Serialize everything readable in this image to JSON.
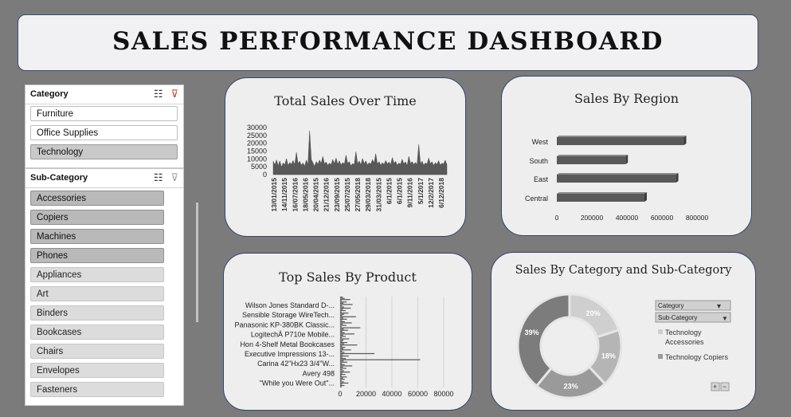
{
  "dashboard": {
    "title": "SALES PERFORMANCE DASHBOARD"
  },
  "category_slicer": {
    "title": "Category",
    "items": [
      {
        "label": "Furniture",
        "selected": false
      },
      {
        "label": "Office Supplies",
        "selected": false
      },
      {
        "label": "Technology",
        "selected": true
      }
    ]
  },
  "subcategory_slicer": {
    "title": "Sub-Category",
    "items": [
      {
        "label": "Accessories",
        "selected": true
      },
      {
        "label": "Copiers",
        "selected": true
      },
      {
        "label": "Machines",
        "selected": true
      },
      {
        "label": "Phones",
        "selected": true
      },
      {
        "label": "Appliances",
        "selected": false
      },
      {
        "label": "Art",
        "selected": false
      },
      {
        "label": "Binders",
        "selected": false
      },
      {
        "label": "Bookcases",
        "selected": false
      },
      {
        "label": "Chairs",
        "selected": false
      },
      {
        "label": "Envelopes",
        "selected": false
      },
      {
        "label": "Fasteners",
        "selected": false
      }
    ]
  },
  "icons": {
    "multi_select": "multi-select-icon",
    "clear_filter": "clear-filter-icon"
  },
  "colors": {
    "bar": "#595959",
    "background": "#7b7b7b",
    "card": "#eeeeef",
    "card_border": "#34446a"
  },
  "pivot_buttons": {
    "category": "Category",
    "subcategory": "Sub-Category"
  },
  "chart_data": [
    {
      "type": "area",
      "title": "Total Sales Over Time",
      "y_ticks": [
        0,
        5000,
        10000,
        15000,
        20000,
        25000,
        30000
      ],
      "ylim": [
        0,
        30000
      ],
      "x_tick_labels": [
        "13/01/2015",
        "14/11/2015",
        "16/07/2016",
        "18/05/2016",
        "20/04/2015",
        "21/12/2016",
        "23/09/2015",
        "25/07/2015",
        "27/05/2018",
        "29/03/2018",
        "31/03/2015",
        "6/1/2015",
        "6/1/2015",
        "9/11/2016",
        "5/1/2017",
        "12/2/2017",
        "6/12/2018"
      ],
      "values": [
        8500,
        6200,
        9400,
        5600,
        8800,
        4700,
        7600,
        6100,
        10200,
        5800,
        7800,
        6500,
        9000,
        6200,
        14200,
        7100,
        8600,
        6000,
        7500,
        5300,
        9200,
        6400,
        28000,
        9600,
        7700,
        5200,
        8400,
        6600,
        9300,
        7100,
        11600,
        6800,
        8100,
        5900,
        7400,
        6300,
        9700,
        7000,
        10600,
        6500,
        8900,
        6100,
        7800,
        6600,
        12400,
        7200,
        8300,
        5600,
        7100,
        6300,
        14700,
        6900,
        8700,
        6200,
        10300,
        7000,
        8800,
        6100,
        7600,
        6700,
        9600,
        7300,
        13300,
        6600,
        8400,
        5900,
        7700,
        6500,
        9000,
        6800,
        8100,
        6300,
        10900,
        7200,
        8500,
        6000,
        7400,
        6600,
        9800,
        6900,
        8200,
        5700,
        11700,
        7100,
        8300,
        6400,
        7900,
        6200,
        19300,
        6800,
        8600,
        6000,
        7500,
        6700,
        10600,
        6900,
        8300,
        5800,
        7700,
        6500,
        8900,
        6100,
        7300,
        6700,
        9200,
        6400
      ]
    },
    {
      "type": "bar",
      "orientation": "horizontal",
      "title": "Sales By Region",
      "categories": [
        "West",
        "South",
        "East",
        "Central"
      ],
      "values": [
        725000,
        392000,
        680000,
        500000
      ],
      "x_ticks": [
        0,
        200000,
        400000,
        600000,
        800000
      ],
      "xlim": [
        0,
        800000
      ]
    },
    {
      "type": "bar",
      "orientation": "horizontal",
      "title": "Top Sales By Product",
      "labels": [
        "Wilson Jones Standard D-...",
        "Sensible Storage WireTech...",
        "Panasonic KP-380BK Classic...",
        "LogitechÂ P710e Mobile...",
        "Hon 4-Shelf Metal Bookcases",
        "Executive Impressions 13-...",
        "Carina 42\"Hx23 3/4\"W...",
        "Avery 498",
        "\"While you Were Out\"..."
      ],
      "x_ticks": [
        0,
        20000,
        40000,
        60000,
        80000
      ],
      "xlim": [
        0,
        80000
      ],
      "values": [
        2000,
        3500,
        7800,
        1200,
        5000,
        2600,
        9600,
        1400,
        3000,
        8200,
        2200,
        4400,
        1100,
        6400,
        3200,
        1700,
        12200,
        2400,
        5200,
        1500,
        3600,
        9000,
        2000,
        4800,
        1200,
        15600,
        2800,
        6100,
        1800,
        3500,
        11000,
        2300,
        4300,
        1400,
        7000,
        2600,
        1900,
        5500,
        3000,
        13200,
        1700,
        4000,
        2500,
        8400,
        1600,
        3300,
        26500,
        2100,
        6600,
        1800,
        4300,
        61800,
        2600,
        5500,
        1400,
        3500,
        9300,
        2200,
        4800,
        1600,
        3000,
        7600,
        1700,
        4100,
        1300,
        5200,
        2300,
        3600,
        1100,
        2800,
        6400,
        1500,
        3300,
        1200
      ]
    },
    {
      "type": "pie",
      "subtype": "doughnut",
      "title": "Sales By Category and Sub-Category",
      "slices": [
        {
          "label": "20%",
          "value": 20,
          "color": "#cfcfcf"
        },
        {
          "label": "18%",
          "value": 18,
          "color": "#b5b5b5"
        },
        {
          "label": "23%",
          "value": 23,
          "color": "#9a9a9a"
        },
        {
          "label": "39%",
          "value": 39,
          "color": "#7c7c7c"
        }
      ],
      "legend": [
        {
          "label": "Technology Accessories",
          "color": "#cfcfcf"
        },
        {
          "label": "Technology Copiers",
          "color": "#9a9a9a"
        }
      ],
      "legend_position": "right"
    }
  ]
}
